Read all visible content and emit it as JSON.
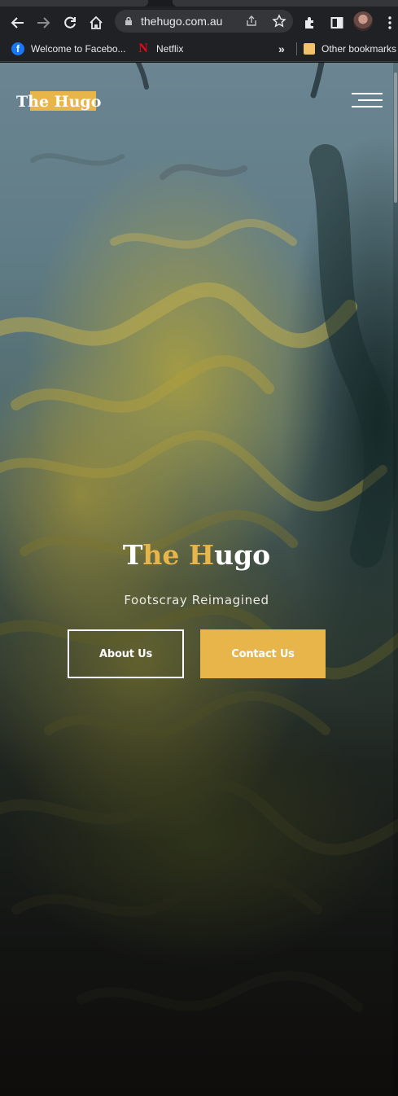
{
  "browser": {
    "address_bar": {
      "url": "thehugo.com.au"
    },
    "bookmarks": [
      {
        "label": "Welcome to Facebo...",
        "icon": "facebook-icon"
      },
      {
        "label": "Netflix",
        "icon": "netflix-icon"
      }
    ],
    "bookmarks_overflow": "»",
    "other_bookmarks": "Other bookmarks"
  },
  "site": {
    "logo": "The Hugo",
    "hero": {
      "title_parts": [
        "T",
        "he",
        " ",
        "H",
        "ugo"
      ],
      "subtitle": "Footscray Reimagined",
      "about_button": "About Us",
      "contact_button": "Contact Us"
    }
  },
  "colors": {
    "accent_gold": "#e8b54a",
    "chrome_bar": "#202124"
  }
}
